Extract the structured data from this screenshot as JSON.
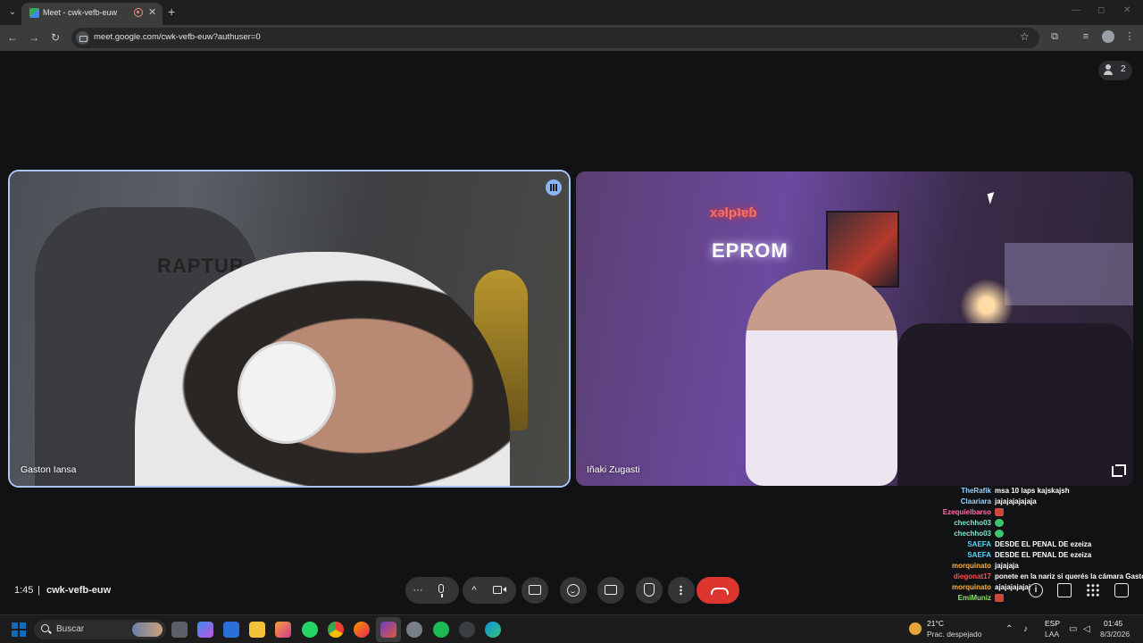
{
  "browser": {
    "tab_title": "Meet - cwk-vefb-euw",
    "url": "meet.google.com/cwk-vefb-euw?authuser=0"
  },
  "participants_count": "2",
  "tiles": [
    {
      "name": "Gaston Iansa",
      "chair_logo": "RAPTUR",
      "speaking": true
    },
    {
      "name": "Iñaki Zugasti",
      "neon_top": "xəlpʇɐɓ",
      "neon_bottom": "EPROM"
    }
  ],
  "chat": [
    {
      "user": "TheRafik",
      "color": "#9ad2ff",
      "message": "msa 10 laps kajskajsh"
    },
    {
      "user": "Claariara",
      "color": "#9ad2ff",
      "message": "jajajajajajaja"
    },
    {
      "user": "Ezequielbarso",
      "color": "#ff6fa8",
      "message": "",
      "emote": "#c94a36"
    },
    {
      "user": "chechho03",
      "color": "#7fe3c8",
      "message": "",
      "emote": "#3ec46d"
    },
    {
      "user": "chechho03",
      "color": "#7fe3c8",
      "message": "",
      "emote": "#3ec46d"
    },
    {
      "user": "SAEFA",
      "color": "#4fd7ff",
      "message": "DESDE EL PENAL DE ezeiza"
    },
    {
      "user": "SAEFA",
      "color": "#4fd7ff",
      "message": "DESDE EL PENAL DE ezeiza"
    },
    {
      "user": "morquinato",
      "color": "#ffb23a",
      "message": "jajajaja"
    },
    {
      "user": "diegonat17",
      "color": "#ff4d4d",
      "message": "ponete en la nariz si querés la cámara Gastón"
    },
    {
      "user": "morquinato",
      "color": "#ffb23a",
      "message": "ajajajajajaj"
    },
    {
      "user": "EmiMuniz",
      "color": "#8fe36a",
      "message": "",
      "emote": "#c94a36"
    }
  ],
  "meeting": {
    "time": "1:45",
    "separator": "|",
    "code": "cwk-vefb-euw"
  },
  "colors": {
    "hangup": "#dc362e",
    "speaking_border": "#a8c7fa",
    "control_bg": "#333537"
  },
  "taskbar": {
    "search_label": "Buscar",
    "temperature": "21°C",
    "weather": "Prac. despejado",
    "lang_top": "ESP",
    "lang_bottom": "LAA",
    "time": "01:45",
    "date": "8/3/2026"
  }
}
